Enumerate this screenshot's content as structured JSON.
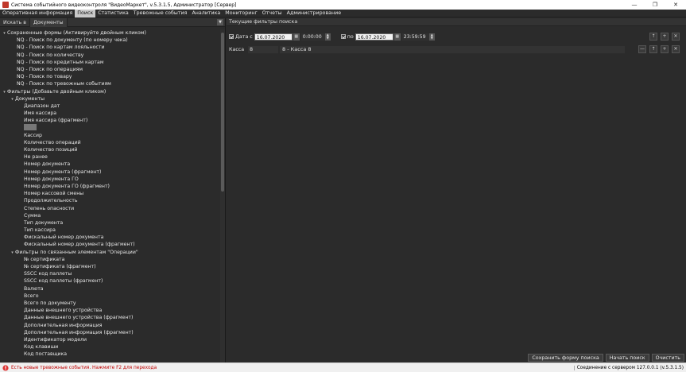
{
  "window": {
    "title": "Система событийного видеоконтроля \"ВидеоМаркет\", v.5.3.1.5, Администратор [Сервер]",
    "minimize": "—",
    "maximize": "❐",
    "close": "✕"
  },
  "menu": [
    "Оперативная информация",
    "Поиск",
    "Статистика",
    "Тревожные события",
    "Аналитика",
    "Мониторинг",
    "Отчеты",
    "Администрирование"
  ],
  "left_tabs": [
    "Искать в",
    "Документы"
  ],
  "tree": {
    "saved_header": "Сохраненные формы (Активируйте двойным кликом)",
    "saved_items": [
      "NQ - Поиск по документу (по номеру чека)",
      "NQ - Поиск по картам лояльности",
      "NQ - Поиск по количеству",
      "NQ - Поиск по кредитным картам",
      "NQ - Поиск по операциям",
      "NQ - Поиск по товару",
      "NQ - Поиск по тревожным событиям"
    ],
    "filters_header": "Фильтры (Добавьте двойным кликом)",
    "docs_group": "Документы",
    "doc_items_a": [
      "Диапазон дат",
      "Имя кассира",
      "Имя кассира (фрагмент)"
    ],
    "doc_items_b": [
      "Кассир",
      "Количество операций",
      "Количество позиций",
      "Не ранее",
      "Номер документа",
      "Номер документа (фрагмент)",
      "Номер документа ГО",
      "Номер документа ГО (фрагмент)",
      "Номер кассовой смены",
      "Продолжительность",
      "Степень опасности",
      "Сумма",
      "Тип документа",
      "Тип кассира",
      "Фискальный номер документа",
      "Фискальный номер документа (фрагмент)"
    ],
    "ops_group": "Фильтры по связанным элементам \"Операции\"",
    "ops_items": [
      "№ сертификата",
      "№ сертификата (фрагмент)",
      "SSCC код паллеты",
      "SSCC код паллеты (фрагмент)",
      "Валюта",
      "Всего",
      "Всего по документу",
      "Данные внешнего устройства",
      "Данные внешнего устройства (фрагмент)",
      "Дополнительная информация",
      "Дополнительная информация (фрагмент)",
      "Идентификатор модели",
      "Код клавиши",
      "Код поставщика"
    ]
  },
  "right": {
    "header": "Текущие фильтры поиска",
    "date_from_label": "Дата с",
    "date_from": "16.07.2020",
    "time_from": "0:00:00",
    "date_to_label": "по",
    "date_to": "16.07.2020",
    "time_to": "23:59:59",
    "kassa_label": "Касса",
    "kassa_value": "8",
    "kassa_desc": "8 - Касса 8",
    "btn_save": "Сохранить форму поиска",
    "btn_search": "Начать поиск",
    "btn_clear": "Очистить"
  },
  "status": {
    "message": "Есть новые тревожные события. Нажмите F2 для перехода",
    "connection": "Соединение с сервером 127.0.0.1 (v.5.3.1.5)"
  }
}
